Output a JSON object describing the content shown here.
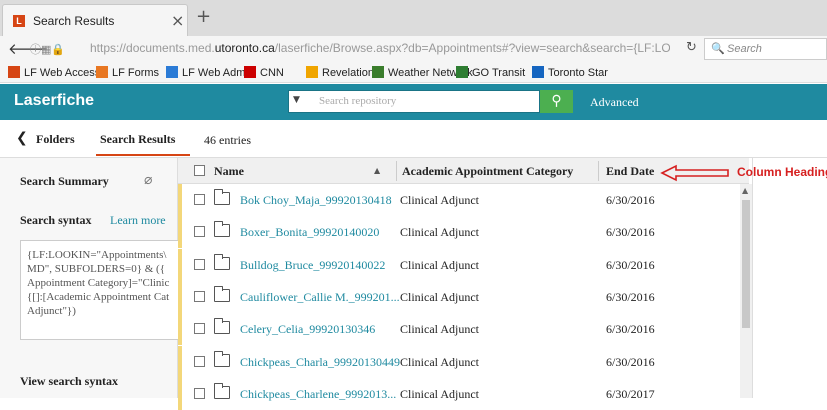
{
  "browser": {
    "tab_title": "Search Results",
    "tab_close": "×",
    "new_tab": "+",
    "url_prefix": "https://documents.med.",
    "url_domain": "utoronto.ca",
    "url_rest": "/laserfiche/Browse.aspx?db=Appointments#?view=search&search={LF:LOOKIN",
    "search_placeholder": "Search",
    "bookmarks": [
      {
        "label": "LF Web Access",
        "color": "#d64514"
      },
      {
        "label": "LF Forms",
        "color": "#e87722"
      },
      {
        "label": "LF Web Admin",
        "color": "#2b7bd6"
      },
      {
        "label": "CNN",
        "color": "#cc0000"
      },
      {
        "label": "Revelation",
        "color": "#f0a500"
      },
      {
        "label": "Weather Network",
        "color": "#3a7d2c"
      },
      {
        "label": "GO Transit",
        "color": "#2e7d32"
      },
      {
        "label": "Toronto Star",
        "color": "#1565c0"
      }
    ]
  },
  "app": {
    "logo": "Laserfiche",
    "search_placeholder": "Search repository",
    "advanced": "Advanced",
    "accent": "#1f8aa0"
  },
  "breadcrumb": {
    "folders": "Folders",
    "search_results": "Search Results",
    "entries": "46 entries"
  },
  "left_pane": {
    "summary_title": "Search Summary",
    "syntax_title": "Search syntax",
    "learn_more": "Learn more",
    "syntax_text": "{LF:LOOKIN=\"Appointments\\\nMD\", SUBFOLDERS=0} & ({\nAppointment Category]=\"Clinic\n{[]:[Academic Appointment Cat\nAdjunct\"})",
    "view_syntax": "View search syntax"
  },
  "grid": {
    "headers": {
      "name": "Name",
      "category": "Academic Appointment Category",
      "end_date": "End Date"
    },
    "rows": [
      {
        "name": "Bok Choy_Maja_99920130418",
        "category": "Clinical Adjunct",
        "end_date": "6/30/2016"
      },
      {
        "name": "Boxer_Bonita_99920140020",
        "category": "Clinical Adjunct",
        "end_date": "6/30/2016"
      },
      {
        "name": "Bulldog_Bruce_99920140022",
        "category": "Clinical Adjunct",
        "end_date": "6/30/2016"
      },
      {
        "name": "Cauliflower_Callie M._999201...",
        "category": "Clinical Adjunct",
        "end_date": "6/30/2016"
      },
      {
        "name": "Celery_Celia_99920130346",
        "category": "Clinical Adjunct",
        "end_date": "6/30/2016"
      },
      {
        "name": "Chickpeas_Charla_99920130449",
        "category": "Clinical Adjunct",
        "end_date": "6/30/2016"
      },
      {
        "name": "Chickpeas_Charlene_9992013...",
        "category": "Clinical Adjunct",
        "end_date": "6/30/2017"
      }
    ]
  },
  "annotation": {
    "label": "Column Heading",
    "color": "#d62020"
  }
}
